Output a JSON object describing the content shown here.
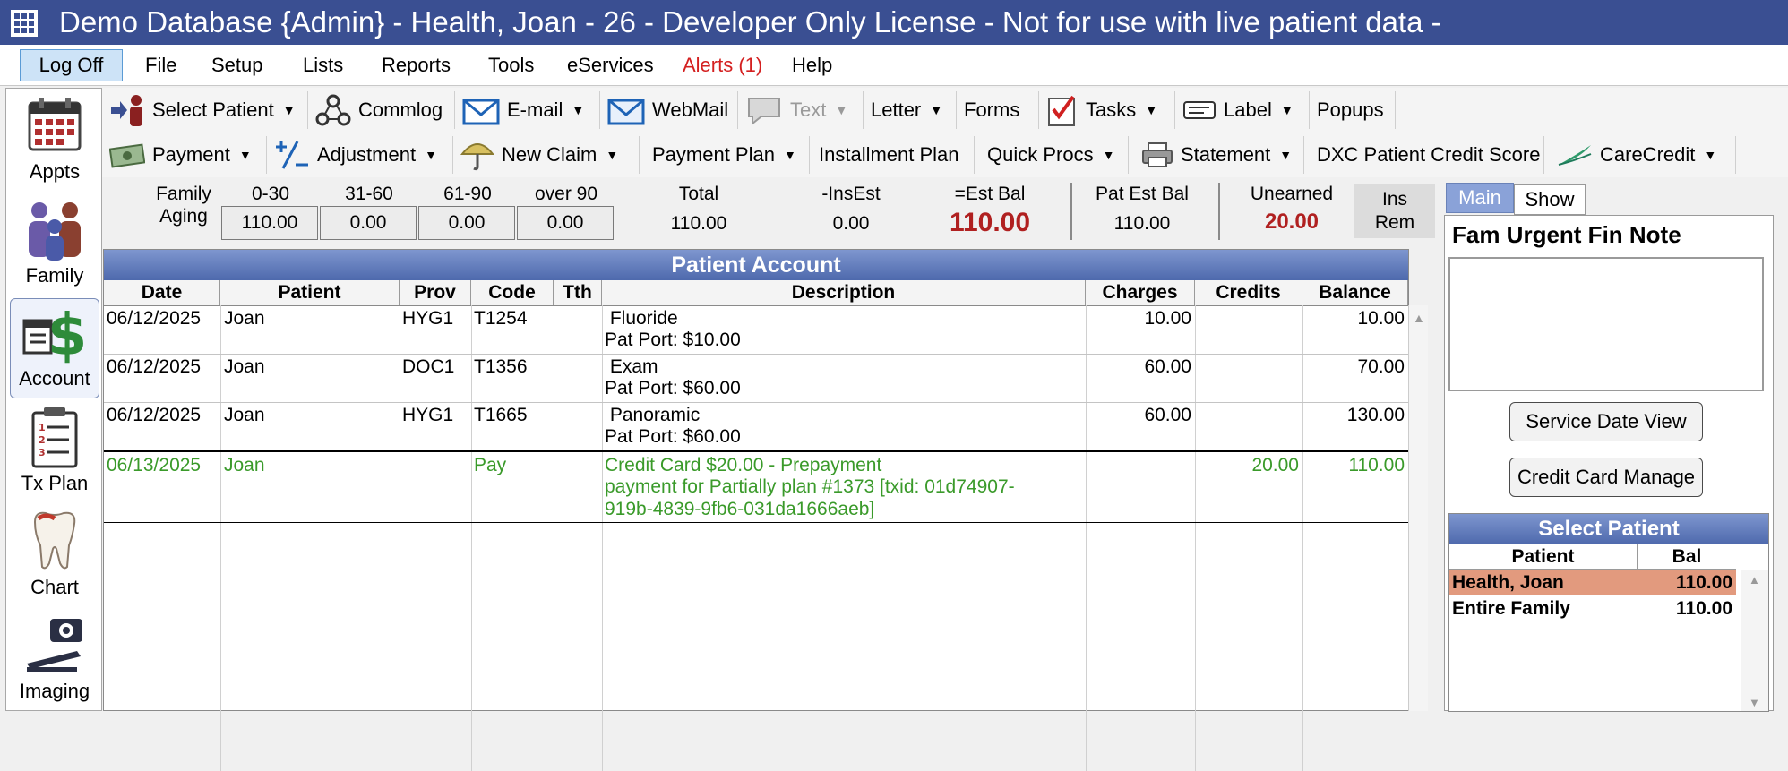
{
  "window": {
    "title": "Demo Database {Admin} - Health, Joan - 26 - Developer Only License - Not for use with live patient data -"
  },
  "menu": {
    "logoff": "Log Off",
    "items": [
      "File",
      "Setup",
      "Lists",
      "Reports",
      "Tools",
      "eServices",
      "Alerts (1)",
      "Help"
    ]
  },
  "modules": [
    "Appts",
    "Family",
    "Account",
    "Tx Plan",
    "Chart",
    "Imaging"
  ],
  "toolbar1": {
    "select_patient": "Select Patient",
    "commlog": "Commlog",
    "email": "E-mail",
    "webmail": "WebMail",
    "text": "Text",
    "letter": "Letter",
    "forms": "Forms",
    "tasks": "Tasks",
    "label": "Label",
    "popups": "Popups"
  },
  "toolbar2": {
    "payment": "Payment",
    "adjustment": "Adjustment",
    "new_claim": "New Claim",
    "payment_plan": "Payment Plan",
    "installment_plan": "Installment Plan",
    "quick_procs": "Quick Procs",
    "statement": "Statement",
    "dxc": "DXC Patient Credit Score",
    "carecredit": "CareCredit"
  },
  "aging": {
    "family_label": "Family",
    "aging_label": "Aging",
    "buckets": [
      {
        "label": "0-30",
        "value": "110.00"
      },
      {
        "label": "31-60",
        "value": "0.00"
      },
      {
        "label": "61-90",
        "value": "0.00"
      },
      {
        "label": "over 90",
        "value": "0.00"
      }
    ],
    "total_label": "Total",
    "total_value": "110.00",
    "insest_label": "-InsEst",
    "insest_value": "0.00",
    "estbal_label": "=Est Bal",
    "estbal_value": "110.00",
    "patestbal_label": "Pat Est Bal",
    "patestbal_value": "110.00",
    "unearned_label": "Unearned",
    "unearned_value": "20.00",
    "insrem_line1": "Ins",
    "insrem_line2": "Rem"
  },
  "account": {
    "title": "Patient Account",
    "columns": [
      "Date",
      "Patient",
      "Prov",
      "Code",
      "Tth",
      "Description",
      "Charges",
      "Credits",
      "Balance"
    ],
    "rows": [
      {
        "date": "06/12/2025",
        "patient": "Joan",
        "prov": "HYG1",
        "code": "T1254",
        "tth": "",
        "desc1": " Fluoride",
        "desc2": "Pat Port: $10.00",
        "desc3": "",
        "charges": "10.00",
        "credits": "",
        "balance": "10.00"
      },
      {
        "date": "06/12/2025",
        "patient": "Joan",
        "prov": "DOC1",
        "code": "T1356",
        "tth": "",
        "desc1": " Exam",
        "desc2": "Pat Port: $60.00",
        "desc3": "",
        "charges": "60.00",
        "credits": "",
        "balance": "70.00"
      },
      {
        "date": "06/12/2025",
        "patient": "Joan",
        "prov": "HYG1",
        "code": "T1665",
        "tth": "",
        "desc1": " Panoramic",
        "desc2": "Pat Port: $60.00",
        "desc3": "",
        "charges": "60.00",
        "credits": "",
        "balance": "130.00"
      },
      {
        "date": "06/13/2025",
        "patient": "Joan",
        "prov": "",
        "code": "Pay",
        "tth": "",
        "desc1": "Credit Card $20.00 - Prepayment",
        "desc2": "payment for Partially plan #1373 [txid: 01d74907-",
        "desc3": "919b-4839-9fb6-031da1666aeb]",
        "charges": "",
        "credits": "20.00",
        "balance": "110.00"
      }
    ]
  },
  "right_panel": {
    "tab_main": "Main",
    "tab_show": "Show",
    "fam_note_title": "Fam Urgent Fin Note",
    "fam_note_text": "",
    "service_date_view": "Service Date View",
    "credit_card_manage": "Credit Card Manage",
    "select_patient_title": "Select Patient",
    "select_cols": [
      "Patient",
      "Bal"
    ],
    "select_rows": [
      {
        "patient": "Health, Joan",
        "bal": "110.00"
      },
      {
        "patient": "Entire Family",
        "bal": "110.00"
      }
    ]
  }
}
